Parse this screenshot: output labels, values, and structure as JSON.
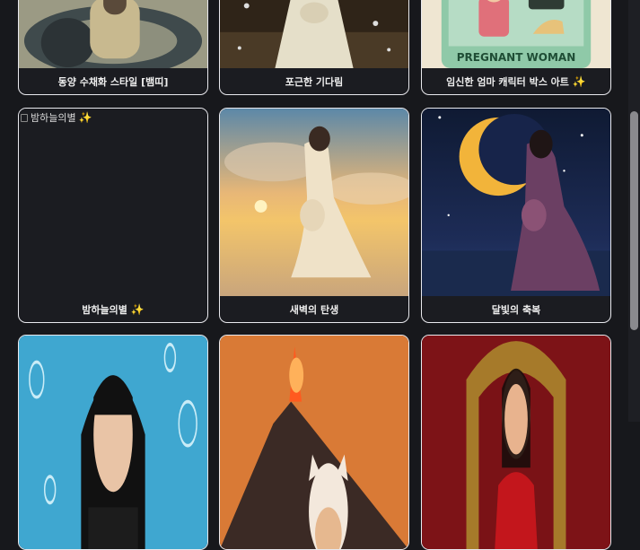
{
  "gallery": {
    "row1": [
      {
        "title": "동양 수채화 스타일 [뱀띠]",
        "sparkle": ""
      },
      {
        "title": "포근한 기다림",
        "sparkle": ""
      },
      {
        "title": "임신한 엄마 캐릭터 박스 아트",
        "sparkle": "✨",
        "poster_text": "PREGNANT WOMAN"
      }
    ],
    "row2": [
      {
        "title": "밤하늘의별",
        "sparkle": "✨",
        "alt": "밤하늘의별",
        "alt_sparkle": "✨"
      },
      {
        "title": "새벽의 탄생",
        "sparkle": ""
      },
      {
        "title": "달빛의 축복",
        "sparkle": ""
      }
    ],
    "row3": [
      {
        "title": "",
        "sparkle": ""
      },
      {
        "title": "",
        "sparkle": ""
      },
      {
        "title": "",
        "sparkle": ""
      }
    ]
  },
  "colors": {
    "background": "#17181c",
    "card_border": "#e9e9ee",
    "sparkle": "#f5c542"
  }
}
